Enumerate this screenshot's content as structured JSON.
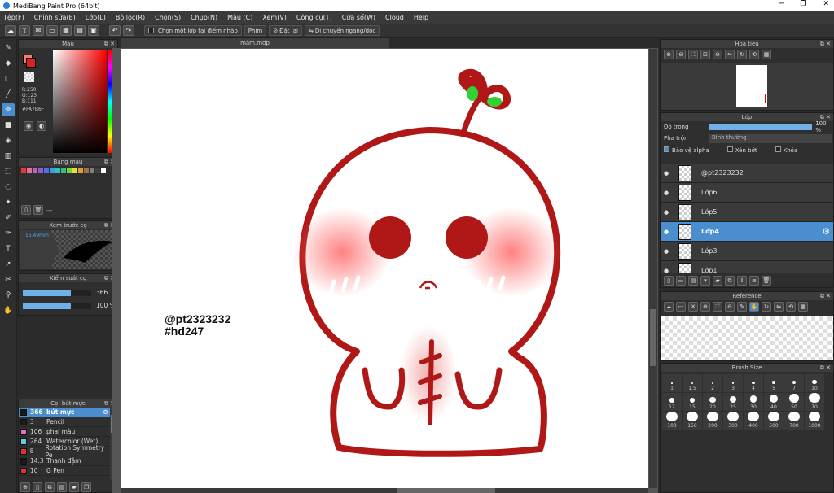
{
  "window": {
    "title": "MediBang Paint Pro (64bit)",
    "min": "─",
    "max": "❐",
    "close": "✕"
  },
  "menu": [
    "Tệp(F)",
    "Chỉnh sửa(E)",
    "Lớp(L)",
    "Bộ lọc(R)",
    "Chọn(S)",
    "Chụp(N)",
    "Màu (C)",
    "Xem(V)",
    "Công cụ(T)",
    "Cửa sổ(W)",
    "Cloud",
    "Help"
  ],
  "toolbar": {
    "pick_layer": "Chọn một lớp tại điểm nhấp",
    "key_label": "Phím",
    "reset": "Đặt lại",
    "flip": "Di chuyển ngang/dọc"
  },
  "color_panel": {
    "title": "Màu",
    "r": "R:250",
    "g": "G:123",
    "b": "B:111",
    "hex": "#FA7B6F",
    "fg": "#FA7B6F"
  },
  "palette_panel": {
    "title": "Bảng màu",
    "menu": "---",
    "swatches": [
      "#e03a3a",
      "#e870a0",
      "#c060c0",
      "#8a60d0",
      "#5070e0",
      "#3aa0e0",
      "#30c0c0",
      "#30c080",
      "#80d040",
      "#e0e040",
      "#e0a030",
      "#a07050",
      "#808080",
      "#404040",
      "#ffffff"
    ]
  },
  "preview_panel": {
    "title": "Xem trước cọ",
    "size": "15.49mm"
  },
  "brush_ctrl": {
    "title": "Kiểm soát cọ",
    "size": "366",
    "opacity": "100 %",
    "size_fill": 0.7,
    "opacity_fill": 0.7
  },
  "brush_list": {
    "title": "Cọ: bút mực",
    "items": [
      {
        "num": "366",
        "name": "bút mực",
        "color": "#1a1a1a"
      },
      {
        "num": "3",
        "name": "Pencil",
        "color": "#1a1a1a"
      },
      {
        "num": "106",
        "name": "phai màu",
        "color": "#e070d0"
      },
      {
        "num": "264",
        "name": "Watercolor (Wet)",
        "color": "#60d0e0"
      },
      {
        "num": "8",
        "name": "Rotation Symmetry Pe",
        "color": "#e03030"
      },
      {
        "num": "14.3",
        "name": "Thanh đậm",
        "color": "#1a1a1a"
      },
      {
        "num": "10",
        "name": "G Pen",
        "color": "#e03030"
      }
    ]
  },
  "canvas": {
    "tab": "mầm.mdp",
    "wm1": "@pt2323232",
    "wm2": "#hd247"
  },
  "navigator": {
    "title": "Hoa tiêu"
  },
  "layers": {
    "title": "Lớp",
    "opacity_label": "Độ trong",
    "opacity": "100 %",
    "blend_label": "Pha trộn",
    "blend": "Bình thường",
    "protect": "Bảo vệ alpha",
    "clip": "Xén bớt",
    "lock": "Khóa",
    "items": [
      "@pt2323232",
      "Lớp6",
      "Lớp5",
      "Lớp4",
      "Lớp3",
      "Lớp1"
    ]
  },
  "reference": {
    "title": "Reference"
  },
  "brush_size": {
    "title": "Brush Size",
    "sizes": [
      "1",
      "1.5",
      "2",
      "3",
      "4",
      "5",
      "7",
      "10",
      "12",
      "15",
      "20",
      "25",
      "30",
      "40",
      "50",
      "70",
      "100",
      "150",
      "200",
      "300",
      "400",
      "500",
      "700",
      "1000"
    ]
  }
}
